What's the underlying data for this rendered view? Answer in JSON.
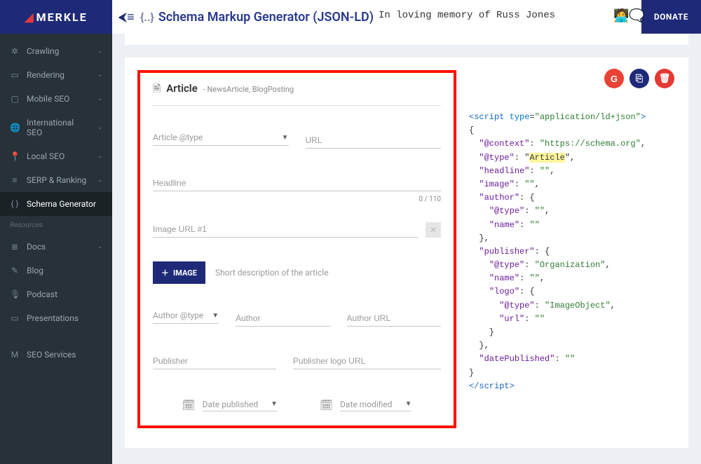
{
  "header": {
    "logo": "MERKLE",
    "page_title": "Schema Markup Generator (JSON-LD)",
    "memory_text": "In loving memory of Russ Jones",
    "donate": "DONATE"
  },
  "sidebar": {
    "items": [
      {
        "icon": "✲",
        "label": "Crawling",
        "expand": true
      },
      {
        "icon": "▭",
        "label": "Rendering",
        "expand": true
      },
      {
        "icon": "▢",
        "label": "Mobile SEO",
        "expand": true
      },
      {
        "icon": "🌐",
        "label": "International SEO",
        "expand": true
      },
      {
        "icon": "📍",
        "label": "Local SEO",
        "expand": true
      },
      {
        "icon": "≡",
        "label": "SERP & Ranking",
        "expand": true
      },
      {
        "icon": "{ }",
        "label": "Schema Generator",
        "expand": false,
        "active": true
      }
    ],
    "resources_label": "Resources",
    "resources": [
      {
        "icon": "≣",
        "label": "Docs",
        "expand": true
      },
      {
        "icon": "✎",
        "label": "Blog"
      },
      {
        "icon": "🎙",
        "label": "Podcast"
      },
      {
        "icon": "▭",
        "label": "Presentations"
      }
    ],
    "seo_services": {
      "icon": "M",
      "label": "SEO Services"
    }
  },
  "panel": {
    "title": "Article",
    "subtitle": "- NewsArticle, BlogPosting",
    "fields": {
      "article_type": "Article @type",
      "url": "URL",
      "headline": "Headline",
      "headline_counter": "0 / 110",
      "image_url": "Image URL #1",
      "add_image": "IMAGE",
      "desc": "Short description of the article",
      "author_type": "Author @type",
      "author": "Author",
      "author_url": "Author URL",
      "publisher": "Publisher",
      "publisher_logo": "Publisher logo URL",
      "date_pub": "Date published",
      "date_mod": "Date modified"
    }
  },
  "actions": {
    "g": "G",
    "copy": "⎘",
    "del": "🗑"
  },
  "code": {
    "open_tag": "<script type=\"application/ld+json\">",
    "obj": {
      "context_k": "\"@context\"",
      "context_v": "\"https://schema.org\"",
      "type_k": "\"@type\"",
      "type_v": "Article",
      "headline_k": "\"headline\"",
      "image_k": "\"image\"",
      "author_k": "\"author\"",
      "atype_k": "\"@type\"",
      "name_k": "\"name\"",
      "publisher_k": "\"publisher\"",
      "pub_type_v": "\"Organization\"",
      "logo_k": "\"logo\"",
      "logo_type_v": "\"ImageObject\"",
      "url_k": "\"url\"",
      "datepub_k": "\"datePublished\"",
      "empty": "\"\""
    },
    "close_tag": "</script>"
  }
}
